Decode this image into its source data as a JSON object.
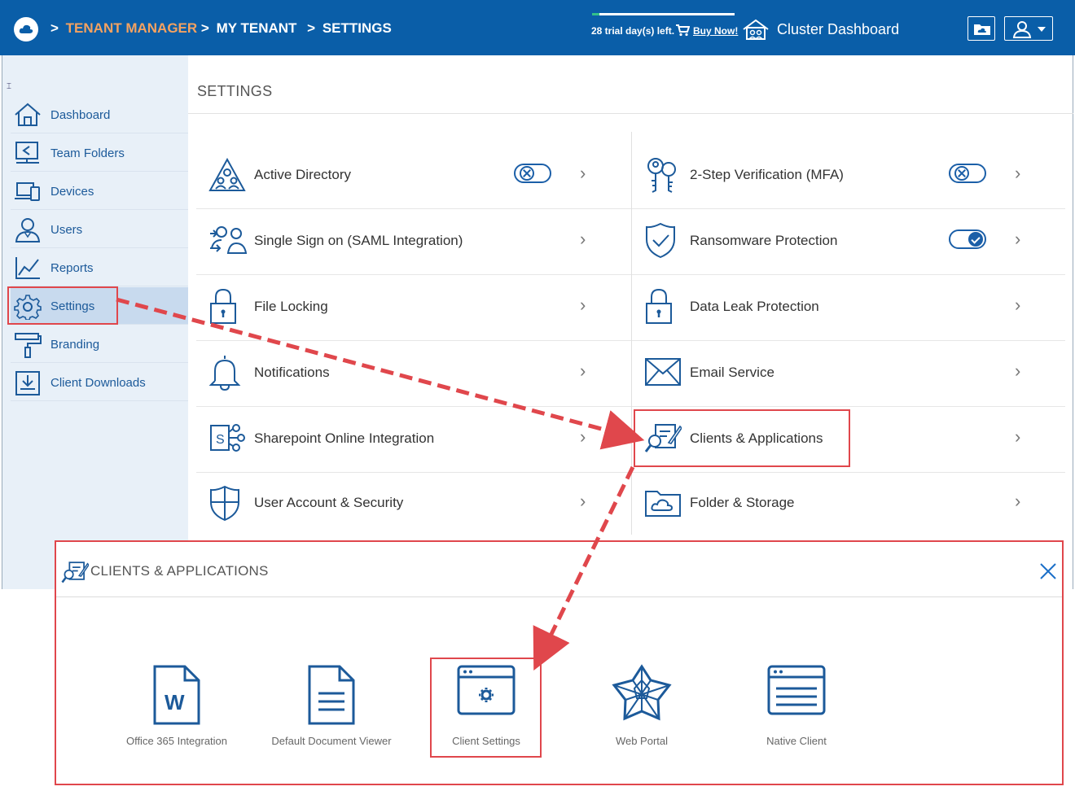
{
  "header": {
    "breadcrumb": [
      ">",
      "TENANT MANAGER",
      ">",
      "MY TENANT",
      ">",
      "SETTINGS"
    ],
    "trial_text": "28 trial day(s) left.",
    "trial_progress": 0.05,
    "buy_now": "Buy Now!",
    "cluster_dashboard": "Cluster Dashboard",
    "colors": {
      "bar": "#0a5ea8",
      "accent": "#f4a261"
    }
  },
  "sidebar": {
    "collapse_glyph": "⌶",
    "items": [
      {
        "label": "Dashboard",
        "icon": "home-icon"
      },
      {
        "label": "Team Folders",
        "icon": "team-folder-icon"
      },
      {
        "label": "Devices",
        "icon": "devices-icon"
      },
      {
        "label": "Users",
        "icon": "user-icon"
      },
      {
        "label": "Reports",
        "icon": "chart-icon"
      },
      {
        "label": "Settings",
        "icon": "gear-icon",
        "active": true
      },
      {
        "label": "Branding",
        "icon": "paint-roller-icon"
      },
      {
        "label": "Client Downloads",
        "icon": "download-icon"
      }
    ]
  },
  "settings": {
    "title": "SETTINGS",
    "left": [
      {
        "label": "Active Directory",
        "toggle": "off"
      },
      {
        "label": "Single Sign on (SAML Integration)"
      },
      {
        "label": "File Locking"
      },
      {
        "label": "Notifications"
      },
      {
        "label": "Sharepoint Online Integration"
      },
      {
        "label": "User Account & Security"
      }
    ],
    "right": [
      {
        "label": "2-Step Verification (MFA)",
        "toggle": "off"
      },
      {
        "label": "Ransomware Protection",
        "toggle": "on"
      },
      {
        "label": "Data Leak Protection"
      },
      {
        "label": "Email Service"
      },
      {
        "label": "Clients & Applications"
      },
      {
        "label": "Folder & Storage"
      }
    ]
  },
  "modal": {
    "title": "CLIENTS & APPLICATIONS",
    "tiles": [
      {
        "label": "Office 365 Integration",
        "icon": "word-document-icon"
      },
      {
        "label": "Default Document Viewer",
        "icon": "document-icon"
      },
      {
        "label": "Client Settings",
        "icon": "client-settings-icon"
      },
      {
        "label": "Web Portal",
        "icon": "web-portal-icon"
      },
      {
        "label": "Native Client",
        "icon": "native-client-icon"
      }
    ]
  }
}
